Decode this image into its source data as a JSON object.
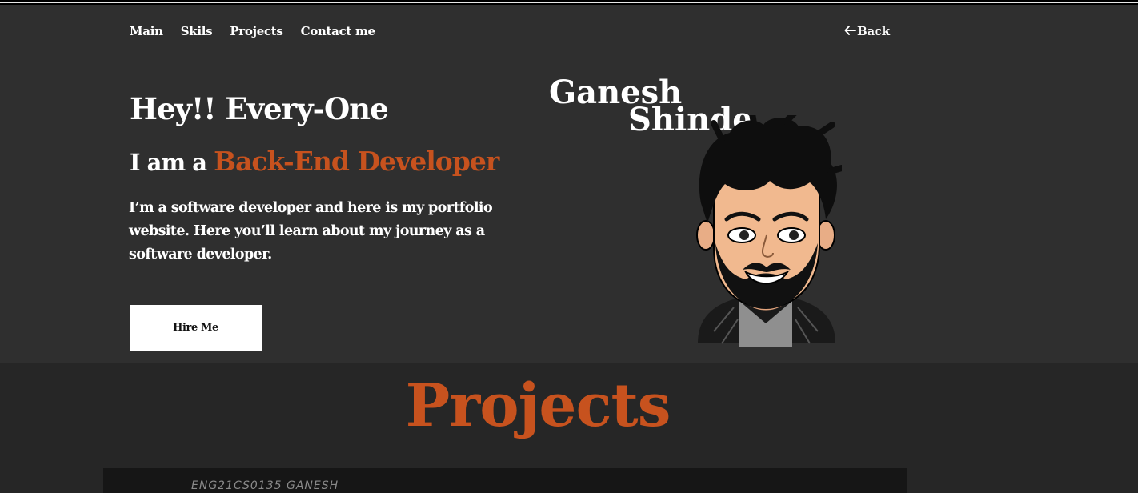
{
  "nav": {
    "items": [
      {
        "label": "Main"
      },
      {
        "label": "Skils"
      },
      {
        "label": "Projects"
      },
      {
        "label": "Contact me"
      }
    ],
    "back_label": "Back",
    "back_icon": "arrow-left-icon"
  },
  "hero": {
    "greeting": "Hey!! Every-One",
    "iam_prefix": "I am a",
    "role": "Back-End Developer",
    "intro": "I’m a software developer and here is my portfolio website. Here you’ll learn about my journey as a software developer.",
    "hire_label": "Hire Me",
    "name_first": "Ganesh",
    "name_last": "Shinde",
    "avatar_icon": "cartoon-avatar-image"
  },
  "projects": {
    "title": "Projects",
    "card_caption": "ENG21CS0135  GANESH"
  },
  "colors": {
    "accent": "#c7521e",
    "background": "#2f2f2f",
    "section_bg": "#262626"
  }
}
